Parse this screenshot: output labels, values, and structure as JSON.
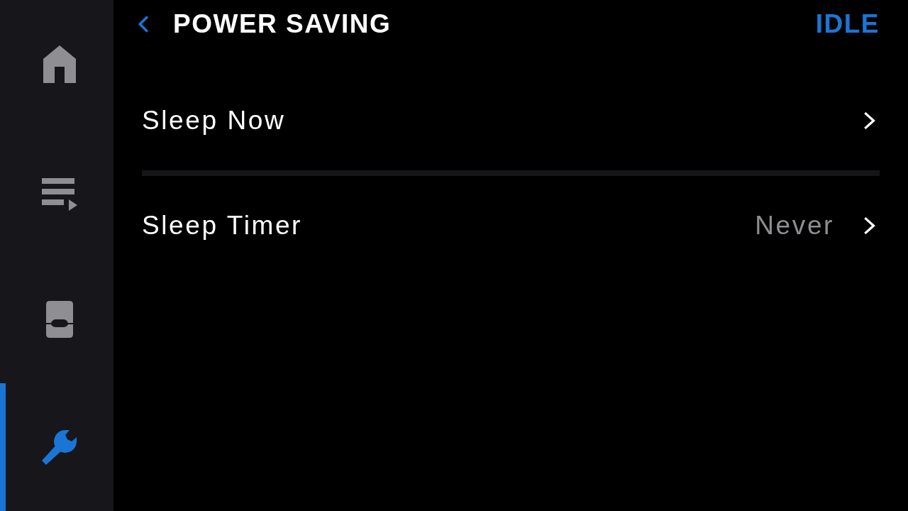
{
  "sidebar": {
    "items": [
      {
        "kind": "home",
        "selected": false
      },
      {
        "kind": "queue",
        "selected": false
      },
      {
        "kind": "device",
        "selected": false
      },
      {
        "kind": "settings",
        "selected": true
      }
    ]
  },
  "header": {
    "title": "POWER SAVING",
    "status": "IDLE"
  },
  "rows": [
    {
      "label": "Sleep Now"
    },
    {
      "label": "Sleep Timer",
      "value": "Never"
    }
  ]
}
